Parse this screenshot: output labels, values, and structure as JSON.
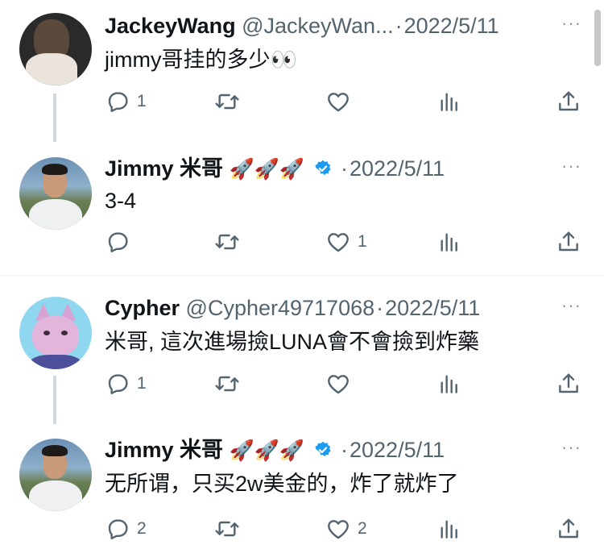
{
  "tweets": [
    {
      "name": "JackeyWang",
      "handle": "@JackeyWan...",
      "sep": "·",
      "date": "2022/5/11",
      "rockets": "",
      "verified": false,
      "text": "jimmy哥挂的多少👀",
      "replies": "1",
      "retweets": "",
      "likes": ""
    },
    {
      "name": "Jimmy 米哥",
      "handle": "",
      "sep": "·",
      "date": "2022/5/11",
      "rockets": "🚀🚀🚀",
      "verified": true,
      "text": "3-4",
      "replies": "",
      "retweets": "",
      "likes": "1"
    },
    {
      "name": "Cypher",
      "handle": "@Cypher49717068",
      "sep": "·",
      "date": "2022/5/11",
      "rockets": "",
      "verified": false,
      "text": "米哥, 這次進場撿LUNA會不會撿到炸藥",
      "replies": "1",
      "retweets": "",
      "likes": ""
    },
    {
      "name": "Jimmy 米哥",
      "handle": "",
      "sep": "·",
      "date": "2022/5/11",
      "rockets": "🚀🚀🚀",
      "verified": true,
      "text": "无所谓，只买2w美金的，炸了就炸了",
      "replies": "2",
      "retweets": "",
      "likes": "2"
    }
  ],
  "more_label": "···",
  "colors": {
    "verified": "#1d9bf0",
    "meta": "#536471",
    "thread_line": "#cfd9de"
  }
}
